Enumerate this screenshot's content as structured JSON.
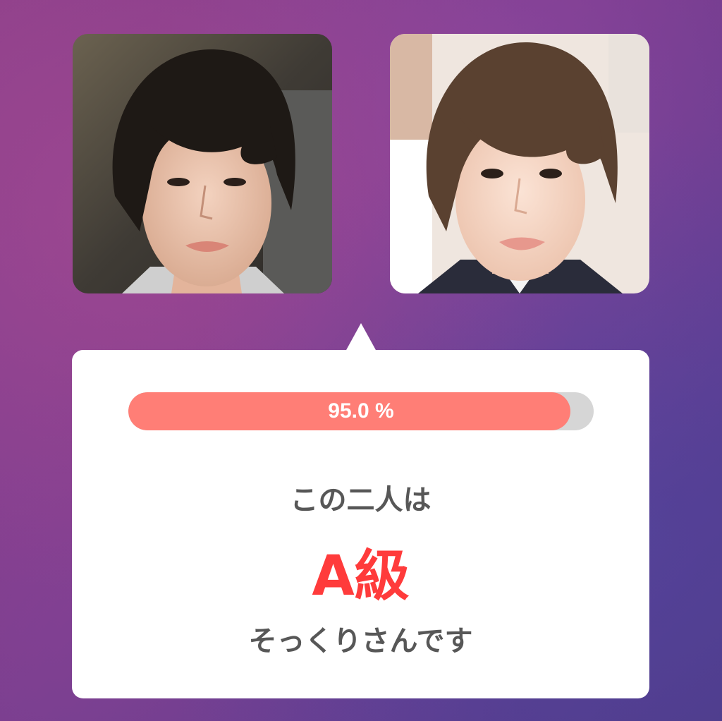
{
  "photos": {
    "left": {
      "icon": "portrait-photo-left"
    },
    "right": {
      "icon": "portrait-photo-right"
    }
  },
  "result": {
    "percent_label": "95.0 %",
    "percent_value": 95.0,
    "line1": "この二人は",
    "grade": "A級",
    "line3": "そっくりさんです"
  },
  "colors": {
    "bar_fill": "#ff7e76",
    "bar_track": "#d6d6d6",
    "grade_text": "#ff3b3b",
    "body_text": "#575757"
  }
}
